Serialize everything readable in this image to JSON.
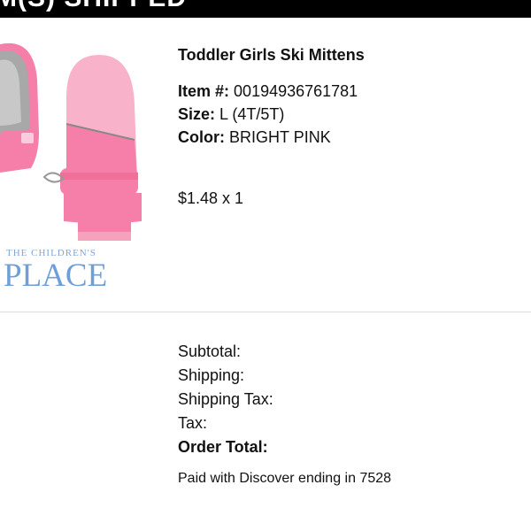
{
  "header": {
    "title": "M(S) SHIPPED"
  },
  "item": {
    "title": "Toddler Girls Ski Mittens",
    "item_label": "Item #:",
    "item_value": "00194936761781",
    "size_label": "Size:",
    "size_value": "L (4T/5T)",
    "color_label": "Color:",
    "color_value": "BRIGHT PINK",
    "price": "$1.48 x 1"
  },
  "brand": {
    "line1": "THE CHILDREN'S",
    "line2": "PLACE"
  },
  "summary": {
    "subtotal_label": "Subtotal:",
    "shipping_label": "Shipping:",
    "shipping_tax_label": "Shipping Tax:",
    "tax_label": "Tax:",
    "order_total_label": "Order Total:"
  },
  "payment": {
    "text": "Paid with Discover ending in 7528"
  },
  "colors": {
    "mitten_pink": "#f57fa8",
    "mitten_light": "#f8b3cb",
    "gray_lining": "#9a9a9a",
    "brand_blue": "#6f9fd8"
  }
}
